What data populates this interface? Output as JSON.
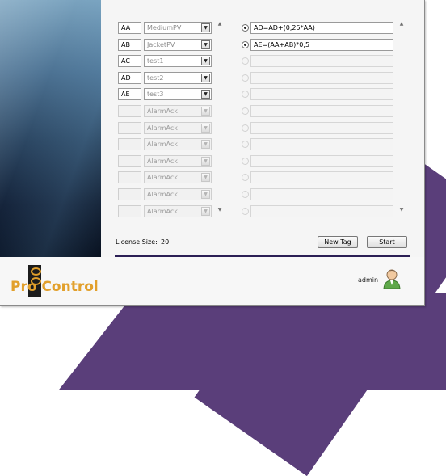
{
  "colors": {
    "accent_purple": "#5a3e7a",
    "divider": "#2b1f55",
    "brand_orange": "#e2a02c"
  },
  "tag_rows": [
    {
      "code": "AA",
      "select": "MediumPV",
      "enabled": true
    },
    {
      "code": "AB",
      "select": "JacketPV",
      "enabled": true
    },
    {
      "code": "AC",
      "select": "test1",
      "enabled": true
    },
    {
      "code": "AD",
      "select": "test2",
      "enabled": true
    },
    {
      "code": "AE",
      "select": "test3",
      "enabled": true
    },
    {
      "code": "",
      "select": "AlarmAck",
      "enabled": false
    },
    {
      "code": "",
      "select": "AlarmAck",
      "enabled": false
    },
    {
      "code": "",
      "select": "AlarmAck",
      "enabled": false
    },
    {
      "code": "",
      "select": "AlarmAck",
      "enabled": false
    },
    {
      "code": "",
      "select": "AlarmAck",
      "enabled": false
    },
    {
      "code": "",
      "select": "AlarmAck",
      "enabled": false
    },
    {
      "code": "",
      "select": "AlarmAck",
      "enabled": false
    }
  ],
  "formula_rows": [
    {
      "text": "AD=AD+(0,25*AA)",
      "selected": true,
      "enabled": true
    },
    {
      "text": "AE=(AA+AB)*0,5",
      "selected": true,
      "enabled": true
    },
    {
      "text": "",
      "selected": false,
      "enabled": false
    },
    {
      "text": "",
      "selected": false,
      "enabled": false
    },
    {
      "text": "",
      "selected": false,
      "enabled": false
    },
    {
      "text": "",
      "selected": false,
      "enabled": false
    },
    {
      "text": "",
      "selected": false,
      "enabled": false
    },
    {
      "text": "",
      "selected": false,
      "enabled": false
    },
    {
      "text": "",
      "selected": false,
      "enabled": false
    },
    {
      "text": "",
      "selected": false,
      "enabled": false
    },
    {
      "text": "",
      "selected": false,
      "enabled": false
    },
    {
      "text": "",
      "selected": false,
      "enabled": false
    }
  ],
  "license": {
    "label": "License Size:",
    "value": "20"
  },
  "buttons": {
    "new_tag": "New Tag",
    "start": "Start"
  },
  "brand": {
    "name": "Pro Control"
  },
  "user": {
    "name": "admin",
    "icon": "user-avatar-icon"
  }
}
